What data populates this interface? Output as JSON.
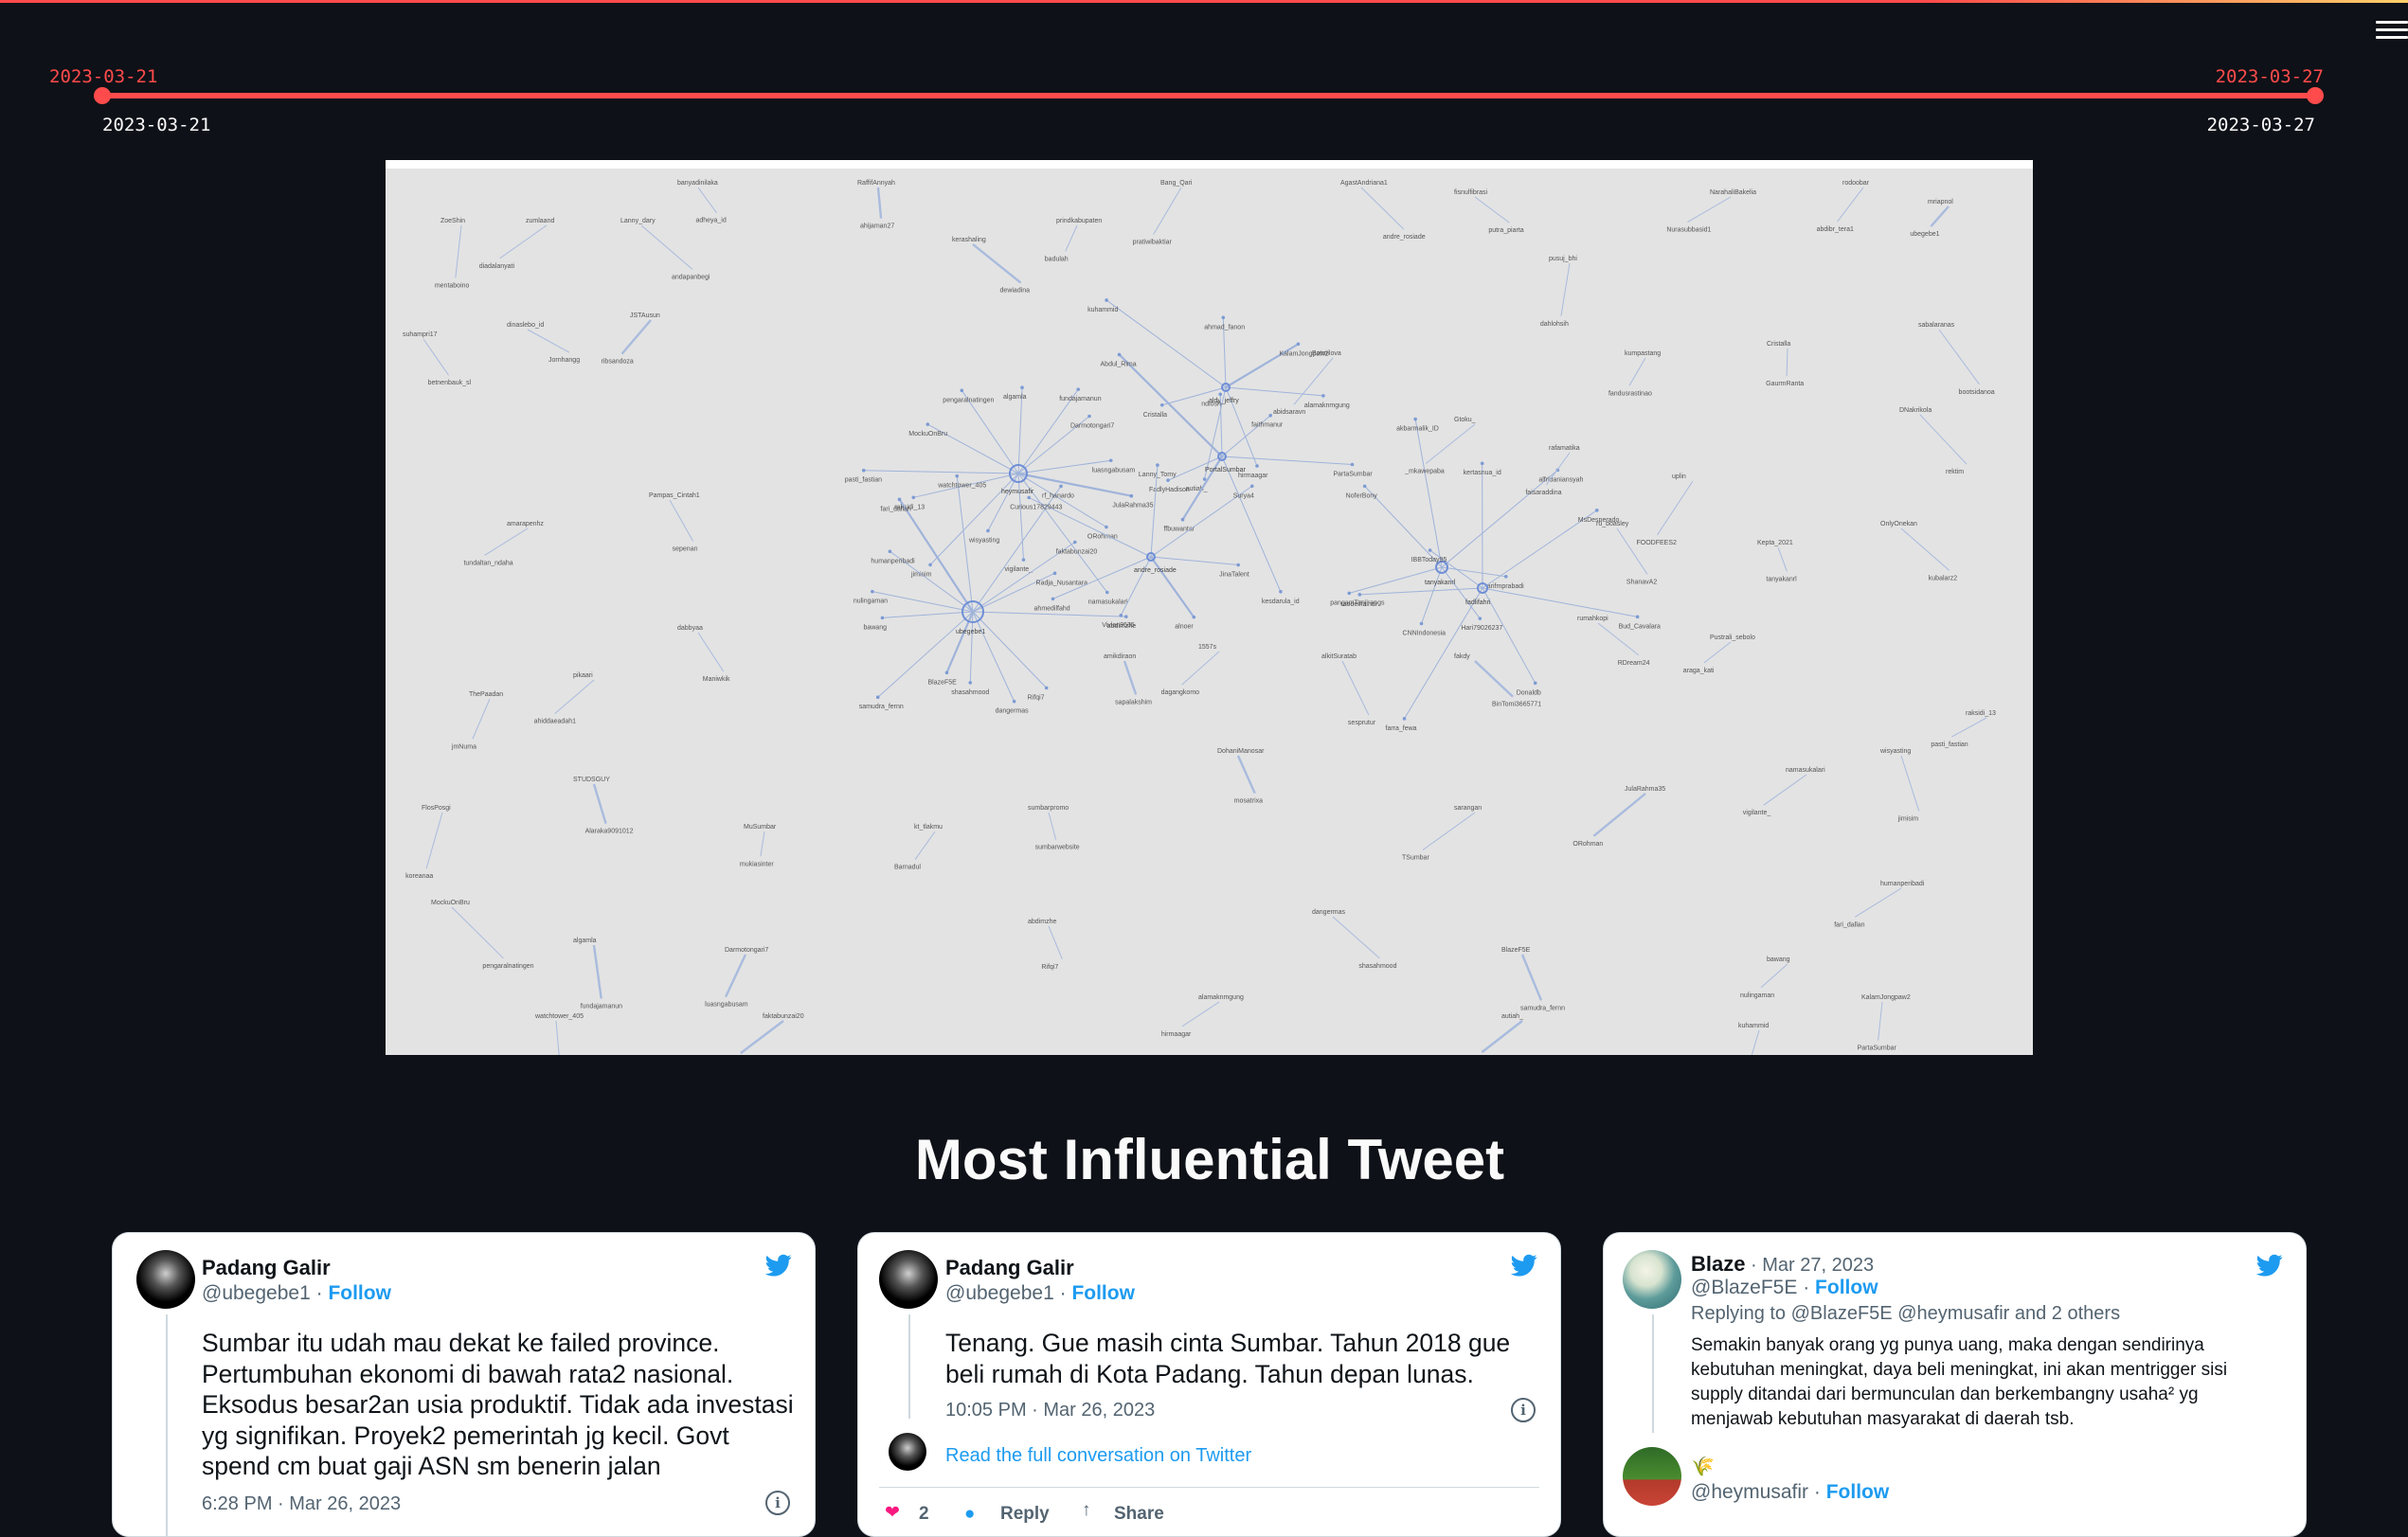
{
  "app": {
    "menu_icon": "hamburger-icon",
    "accent_color": "#ff4b4b",
    "background_color": "#0e1117"
  },
  "date_slider": {
    "min_label": "2023-03-21",
    "max_label": "2023-03-27",
    "selected_start": "2023-03-21",
    "selected_end": "2023-03-27"
  },
  "network_graph": {
    "hubs": [
      {
        "id": "heymusafir",
        "label": "heymusafir"
      },
      {
        "id": "ubegebe1",
        "label": "ubegebe1"
      },
      {
        "id": "aldy_jeffry",
        "label": "aldy_jeffry"
      },
      {
        "id": "PortalSumbar",
        "label": "PortalSumbar"
      },
      {
        "id": "andre_rosiade",
        "label": "andre_rosiade"
      },
      {
        "id": "tanyakanrl",
        "label": "tanyakanrl"
      },
      {
        "id": "fadlifahri",
        "label": "fadlifahri"
      }
    ],
    "labels": [
      "JulaRahma35",
      "ORohman",
      "namasukalari",
      "vigilante_",
      "wisyasting",
      "jimisim",
      "raksidi_13",
      "pasti_fastian",
      "MockuOnBru",
      "pengaralnatingen",
      "algamla",
      "fundajamanun",
      "Darmotongari7",
      "luasngabusam",
      "abdimzhe",
      "Rifqi7",
      "dangermas",
      "shasahmood",
      "BlazeF5E",
      "samudra_fernn",
      "bawang",
      "nulingaman",
      "humanperibadi",
      "fari_dallan",
      "watchtower_405",
      "rf_hanardo",
      "faktabunzai20",
      "Radja_Nusantara",
      "alamaknmgung",
      "hirmaagar",
      "autiah_",
      "Cristalla",
      "kuhammid",
      "ahmad_fanon",
      "KalamJongpaw2",
      "PartaSumbar",
      "kesdarula_id",
      "ffbuwantar",
      "FadlyHadison",
      "Abdul_Rima",
      "ndiosh",
      "faithmanur",
      "JinaTalent",
      "alnoer",
      "Vivian9535",
      "ahmedilfahd",
      "Curious17829443",
      "Lanny_Tomy",
      "Surya4",
      "arifmprabadi",
      "Hari79026237",
      "CNNIndonesia",
      "pangamTanjirangs",
      "NoferBony",
      "akbarmalik_ID",
      "alfridaniansyah",
      "Bud_Cavalara",
      "Donaldb",
      "farra_fewa",
      "raodeiffaindi",
      "IBBToday95",
      "kertasnua_id",
      "MsDesperado",
      "ZoeShin",
      "mentaboino",
      "zumlaand",
      "diadalanyati",
      "Lanny_dary",
      "andapanbegi",
      "banyadinilaka",
      "adheya_id",
      "RaffifAnnyah",
      "ahijaman27",
      "kerashaling",
      "dewiadina",
      "prindkabupaten",
      "badulah",
      "Bang_Qari",
      "pratiwibaktiar",
      "AgastAndriana1",
      "andre_rosiade",
      "fisnulfibrasi",
      "putra_piarta",
      "pusuj_bhi",
      "dahlohsih",
      "NarahaliBakelia",
      "Nurasubbasid1",
      "rodoobar",
      "abdibr_tera1",
      "mriapnol",
      "ubegebe1",
      "suhampri17",
      "betnenbauk_sl",
      "dinaslebo_id",
      "Jornhangg",
      "JSTAusun",
      "ribsandoza",
      "Botmilova",
      "abidsaravn",
      "Gtoku_",
      "_mkawepaba",
      "kumpastang",
      "fandusrastinao",
      "Cristalla",
      "GaurmRanta",
      "sabalaranas",
      "bootsidanoa",
      "DNakrikola",
      "rektim",
      "amarapenhz",
      "tundaltan_ndaha",
      "Pampas_Cintah1",
      "sepenan",
      "rafamatika",
      "faisaraddina",
      "uplin",
      "FOODFEES2",
      "ru_boasley",
      "ShanavA2",
      "Kepta_2021",
      "tanyakanrl",
      "OnlyOnekan",
      "kubalarz2",
      "ThePaadan",
      "jmNuma",
      "pikaari",
      "ahiddaeadah1",
      "dabbyaa",
      "Maniwkik",
      "amikdiraon",
      "sapalakshim",
      "1557s",
      "dagangkomo",
      "alkitSuratab",
      "sesprutur",
      "fakdy",
      "BinTomi3665771",
      "rumahkopi",
      "RDream24",
      "Pustrali_sebolo",
      "araga_kati",
      "FlosPosgi",
      "koreanaa",
      "STUDSGUY",
      "Alaraka9091012",
      "MuSumbar",
      "mukiasinter",
      "kt_tlakmu",
      "Barnadul",
      "sumbarpromo",
      "sumbarwebsite",
      "DohaniManosar",
      "mosatrixa",
      "sarangan",
      "TSumbar"
    ]
  },
  "section": {
    "title": "Most Influential Tweet"
  },
  "tweets": [
    {
      "name": "Padang Galir",
      "handle": "@ubegebe1",
      "follow": "Follow",
      "lines": [
        "Sumbar itu udah mau dekat ke failed province.",
        "Pertumbuhan ekonomi di bawah rata2 nasional.",
        "Eksodus besar2an usia produktif. Tidak ada investasi",
        "yg signifikan. Proyek2 pemerintah jg kecil. Govt",
        "spend cm buat gaji ASN sm benerin jalan"
      ],
      "timestamp": "6:28 PM · Mar 26, 2023",
      "avatar_icon": "user-avatar-icon",
      "platform_icon": "twitter-bird-icon"
    },
    {
      "name": "Padang Galir",
      "handle": "@ubegebe1",
      "follow": "Follow",
      "lines": [
        "Tenang. Gue masih cinta Sumbar. Tahun 2018 gue",
        "beli rumah di Kota Padang. Tahun depan lunas."
      ],
      "timestamp": "10:05 PM · Mar 26, 2023",
      "read_more": "Read the full conversation on Twitter",
      "like_count": "2",
      "reply_label": "Reply",
      "share_label": "Share",
      "platform_icon": "twitter-bird-icon"
    },
    {
      "name": "Blaze",
      "date": "Mar 27, 2023",
      "handle": "@BlazeF5E",
      "follow": "Follow",
      "reply_prefix": "Replying to",
      "reply_targets": "@BlazeF5E @heymusafir",
      "reply_suffix": "and 2 others",
      "lines": [
        "Semakin banyak orang yg punya uang, maka dengan sendirinya",
        "kebutuhan meningkat, daya beli meningkat, ini akan mentrigger sisi",
        "supply ditandai dari bermunculan dan berkembangny usaha² yg",
        "menjawab kebutuhan masyarakat di daerah tsb."
      ],
      "second_author_name": "🌾",
      "second_author_handle": "@heymusafir",
      "second_author_follow": "Follow",
      "platform_icon": "twitter-bird-icon"
    }
  ]
}
